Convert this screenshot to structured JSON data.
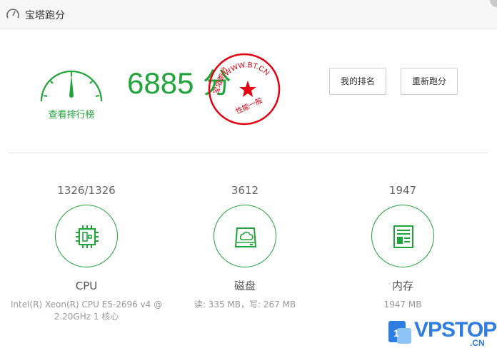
{
  "window": {
    "title": "宝塔跑分"
  },
  "gauge": {
    "label": "查看排行榜"
  },
  "score": {
    "value": "6885",
    "unit": "分"
  },
  "seal": {
    "url_text": "WWW.BT.CN",
    "left_text": "宝塔跑分",
    "level_text": "性能一般"
  },
  "buttons": {
    "rank": "我的排名",
    "retest": "重新跑分"
  },
  "metrics": [
    {
      "value": "1326/1326",
      "name": "CPU",
      "detail": "Intel(R) Xeon(R) CPU E5-2696 v4 @ 2.20GHz 1 核心",
      "icon": "cpu-icon"
    },
    {
      "value": "3612",
      "name": "磁盘",
      "detail": "读: 335 MB，写: 267 MB",
      "icon": "disk-icon"
    },
    {
      "value": "1947",
      "name": "内存",
      "detail": "1947 MB",
      "icon": "memory-icon"
    }
  ],
  "watermark": {
    "text": "VPSTOP",
    "sub": ".CN"
  },
  "colors": {
    "accent": "#20a53a",
    "seal": "#e60012"
  }
}
